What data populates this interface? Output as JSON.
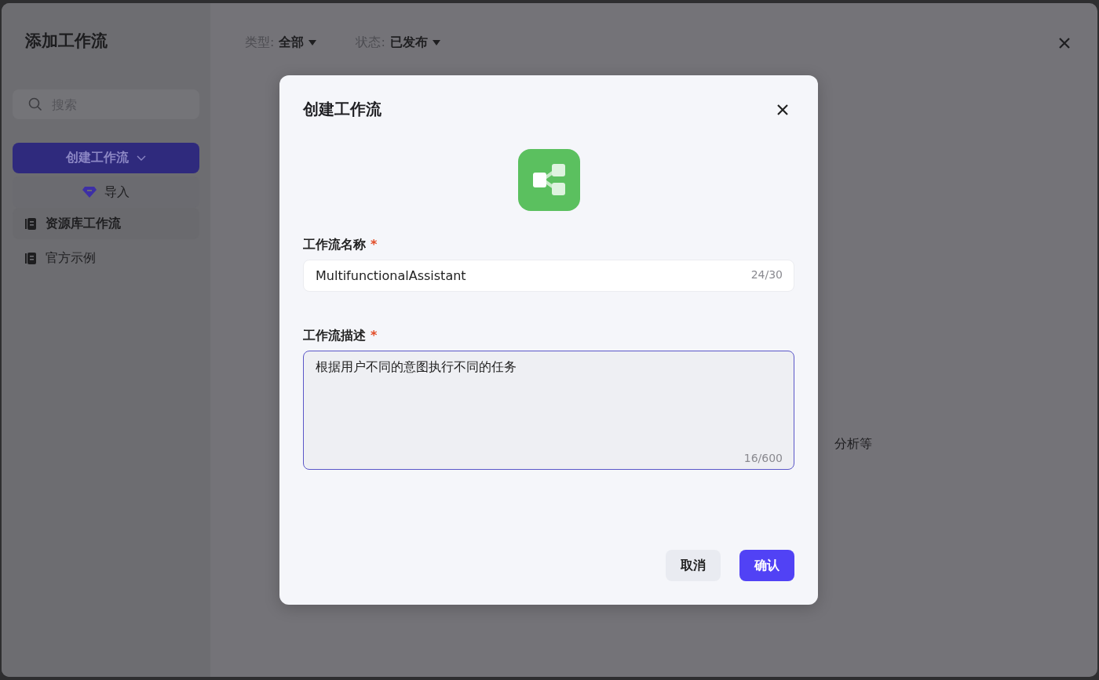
{
  "sidebar": {
    "title": "添加工作流",
    "search": {
      "placeholder": "搜索"
    },
    "create_button": "创建工作流",
    "import_button": "导入",
    "items": [
      {
        "label": "资源库工作流",
        "selected": true
      },
      {
        "label": "官方示例",
        "selected": false
      }
    ]
  },
  "filters": [
    {
      "label": "类型:",
      "value": "全部"
    },
    {
      "label": "状态:",
      "value": "已发布"
    }
  ],
  "background_text": "分析等",
  "dialog": {
    "title": "创建工作流",
    "name_field": {
      "label": "工作流名称",
      "required_mark": "*",
      "value": "MultifunctionalAssistant",
      "counter": "24/30"
    },
    "description_field": {
      "label": "工作流描述",
      "required_mark": "*",
      "value": "根据用户不同的意图执行不同的任务",
      "counter": "16/600",
      "focused": true
    },
    "buttons": [
      {
        "label": "取消",
        "kind": "secondary"
      },
      {
        "label": "确认",
        "kind": "primary"
      }
    ]
  }
}
